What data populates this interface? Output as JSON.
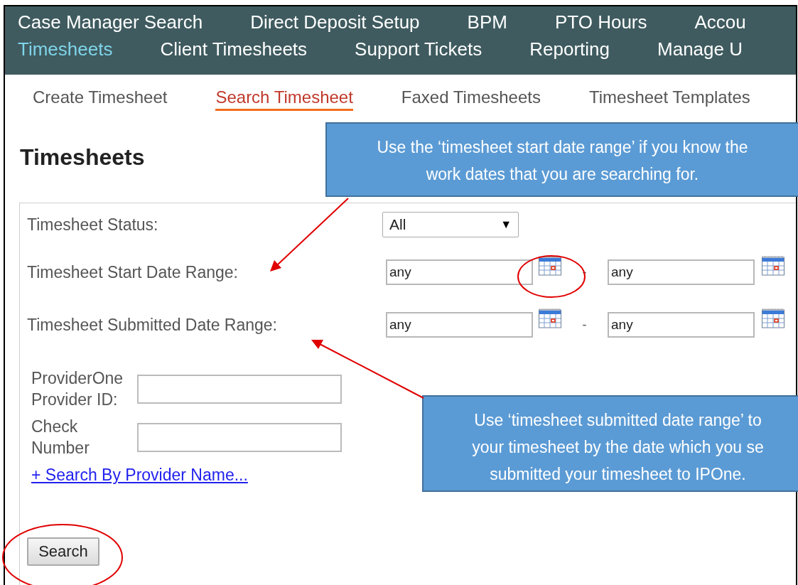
{
  "nav_rows": [
    {
      "items": [
        {
          "label": "Case Manager Search",
          "selected": false
        },
        {
          "label": "Direct Deposit Setup",
          "selected": false
        },
        {
          "label": "BPM",
          "selected": false
        },
        {
          "label": "PTO Hours",
          "selected": false
        },
        {
          "label": "Accou",
          "selected": false
        }
      ]
    },
    {
      "items": [
        {
          "label": "Timesheets",
          "selected": true
        },
        {
          "label": "Client Timesheets",
          "selected": false
        },
        {
          "label": "Support Tickets",
          "selected": false
        },
        {
          "label": "Reporting",
          "selected": false
        },
        {
          "label": "Manage U",
          "selected": false
        }
      ]
    }
  ],
  "sub_tabs": [
    {
      "label": "Create Timesheet",
      "selected": false
    },
    {
      "label": "Search Timesheet",
      "selected": true
    },
    {
      "label": "Faxed Timesheets",
      "selected": false
    },
    {
      "label": "Timesheet Templates",
      "selected": false
    }
  ],
  "page_title": "Timesheets",
  "form": {
    "status": {
      "label": "Timesheet Status:",
      "value": "All",
      "arrow": "▼"
    },
    "date_ranges": [
      {
        "label": "Timesheet Start Date Range:",
        "from": "any",
        "separator": "-",
        "to": "any"
      },
      {
        "label": "Timesheet Submitted Date Range:",
        "from": "any",
        "separator": "-",
        "to": "any"
      }
    ],
    "text_fields": [
      {
        "label": "ProviderOne Provider ID:"
      },
      {
        "label": "Check Number"
      }
    ],
    "link": "+ Search By Provider Name...",
    "button": "Search"
  },
  "callouts": [
    {
      "lines": [
        "Use the ‘timesheet start date range’ if you know the",
        "work dates that you are searching for."
      ]
    },
    {
      "lines": [
        "Use ‘timesheet submitted date range’ to",
        "your timesheet by the date which you se",
        "submitted your timesheet to IPOne."
      ]
    }
  ]
}
